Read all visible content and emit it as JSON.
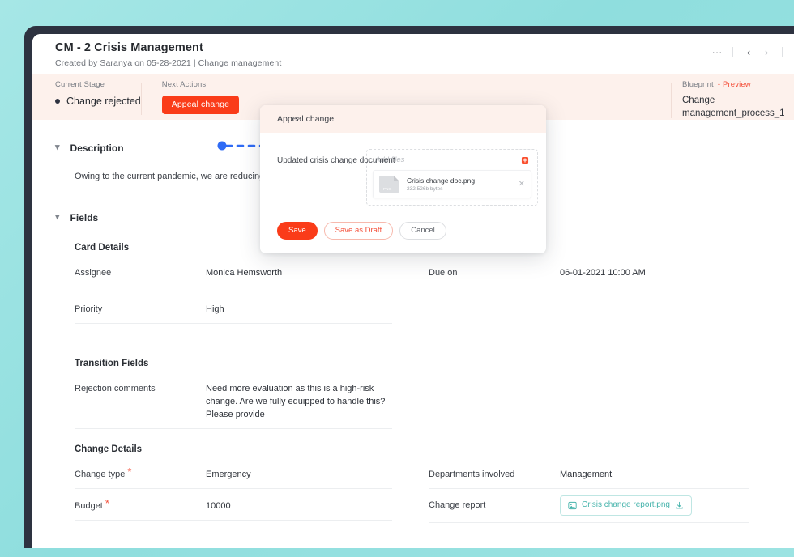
{
  "header": {
    "title": "CM - 2 Crisis Management",
    "subtitle": "Created by Saranya on 05-28-2021 | Change management",
    "actions": {
      "more": "···",
      "prev": "‹",
      "next": "›",
      "close": "✕"
    }
  },
  "stage_bar": {
    "current_stage_label": "Current Stage",
    "current_stage_value": "Change rejected",
    "next_actions_label": "Next Actions",
    "next_action_button": "Appeal change",
    "blueprint_label": "Blueprint",
    "blueprint_preview": "- Preview",
    "blueprint_name": "Change management_process_1"
  },
  "description": {
    "section_title": "Description",
    "text": "Owing to the current pandemic, we are reducing the orga"
  },
  "fields": {
    "section_title": "Fields",
    "card_details": {
      "title": "Card Details",
      "rows": [
        {
          "label": "Assignee",
          "value": "Monica Hemsworth",
          "required": false
        },
        {
          "label": "Due on",
          "value": "06-01-2021 10:00 AM",
          "required": false
        },
        {
          "label": "Priority",
          "value": "High",
          "required": false
        }
      ]
    },
    "transition_fields": {
      "title": "Transition Fields",
      "rows": [
        {
          "label": "Rejection comments",
          "value": "Need more evaluation as this is a high-risk change. Are we fully equipped to handle this? Please provide",
          "required": false
        }
      ]
    },
    "change_details": {
      "title": "Change Details",
      "rows": [
        {
          "label": "Change type",
          "value": "Emergency",
          "required": true
        },
        {
          "label": "Departments involved",
          "value": "Management",
          "required": false
        },
        {
          "label": "Budget",
          "value": "10000",
          "required": true
        },
        {
          "label": "Change report",
          "value": "",
          "required": false
        }
      ],
      "change_report_file": "Crisis change report.png"
    }
  },
  "modal": {
    "title": "Appeal change",
    "upload_label": "Updated crisis change document",
    "upload_placeholder": "Add files",
    "file": {
      "name": "Crisis change doc.png",
      "size": "232.526b bytes",
      "ext": "PNG",
      "remove": "✕"
    },
    "buttons": {
      "save": "Save",
      "save_as_draft": "Save as Draft",
      "cancel": "Cancel"
    }
  },
  "colors": {
    "page_background": "#8fdede",
    "frame": "#2d3240",
    "accent_red": "#fa3c19",
    "stage_bar": "#fdf1ec",
    "teal_chip": "#45b3ab",
    "connector_blue": "#2f6bf5"
  }
}
